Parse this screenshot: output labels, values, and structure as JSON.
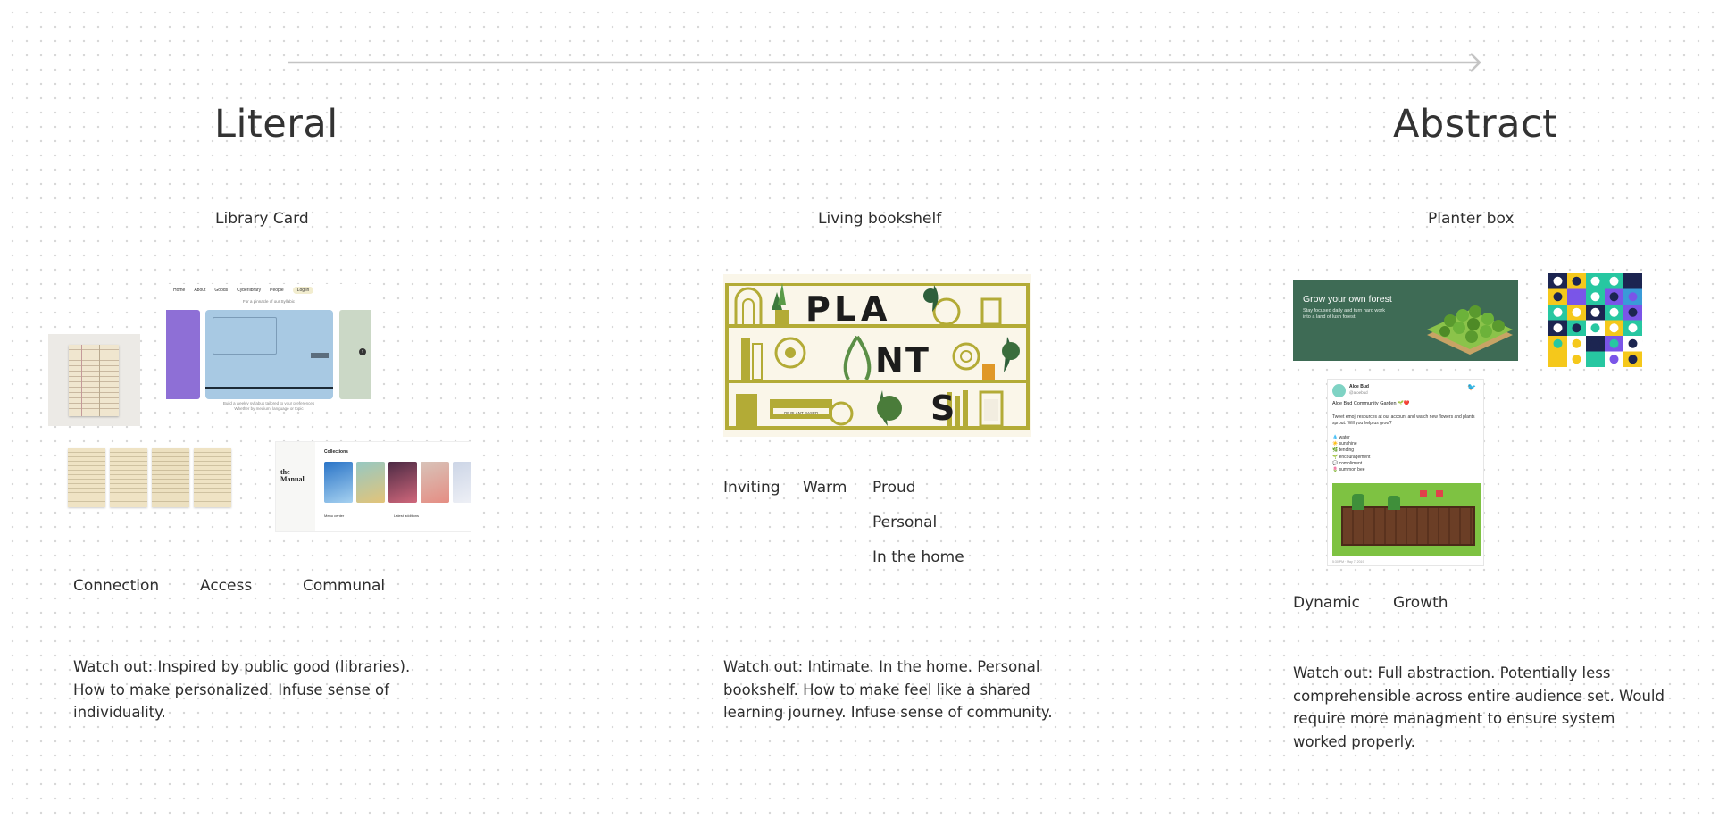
{
  "spectrum": {
    "left_label": "Literal",
    "right_label": "Abstract"
  },
  "columns": [
    {
      "title": "Library Card",
      "tags": [
        "Connection",
        "Access",
        "Communal"
      ],
      "note": "Watch out: Inspired by public good (libraries).\nHow to make personalized. Infuse sense of\nindividuality.",
      "mock_site": {
        "nav": [
          "Home",
          "About",
          "Goods",
          "Cyberlibrary",
          "People",
          "Log in"
        ],
        "tagline": "For a pinnacle of our Syllabic",
        "caption": "Build a weekly syllabus tailored to your preferences\nWhether by medium, language or topic"
      },
      "mock_manual": {
        "brand": "the Manual",
        "section": "Collections",
        "col1": "Menu center",
        "col2": "Latest additions"
      }
    },
    {
      "title": "Living bookshelf",
      "tags": [
        "Inviting",
        "Warm",
        "Proud",
        "Personal",
        "In the home"
      ],
      "note": "Watch out: Intimate. In the home. Personal\nbookshelf. How to make feel like a shared\nlearning journey. Infuse sense of community.",
      "banner_letters": [
        "P",
        "L",
        "A",
        "N",
        "T",
        "S"
      ],
      "banner_book_spine": "OF PLANT BASED"
    },
    {
      "title": "Planter box",
      "tags": [
        "Dynamic",
        "Growth"
      ],
      "note": "Watch out: Full abstraction. Potentially less\ncomprehensible across entire audience set. Would\nrequire more managment to ensure system\nworked properly.",
      "forest_card": {
        "title": "Grow your own forest",
        "body": "Stay focused daily and turn hard work\ninto a land of lush forest."
      },
      "tweet": {
        "name": "Aloe Bud",
        "handle": "@aloebud",
        "headline": "Aloe Bud Community Garden 🌱❤️",
        "body": "Tweet emoji resources at our account and watch new flowers and plants sprout. Will you help us grow?",
        "list": [
          "💧 water",
          "☀️ sunshine",
          "🌿 tending",
          "🌱 encouragement",
          "💬 compliment",
          "🌷 summon bee"
        ],
        "footer": "5:30 PM · May 7, 2019"
      }
    }
  ],
  "colors": {
    "arrow": "#c4c4c4",
    "plants_gold": "#b3ab36",
    "forest_green": "#3e6b55",
    "grid_purple": "#7a55e8",
    "grid_teal": "#27c7a1",
    "grid_yellow": "#f5c81b",
    "grid_navy": "#1c2551"
  }
}
